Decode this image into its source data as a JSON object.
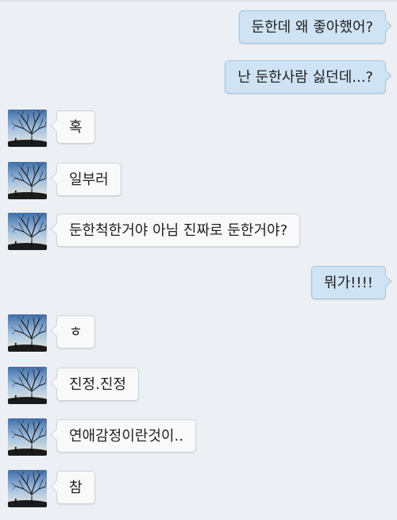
{
  "conversation": {
    "messages": [
      {
        "sender": "me",
        "text": "둔한데 왜 좋아했어?"
      },
      {
        "sender": "me",
        "text": "난 둔한사람 싫던데...?"
      },
      {
        "sender": "friend",
        "text": "혹"
      },
      {
        "sender": "friend",
        "text": "일부러"
      },
      {
        "sender": "friend",
        "text": "둔한척한거야 아님 진짜로 둔한거야?"
      },
      {
        "sender": "me",
        "text": "뭐가!!!!"
      },
      {
        "sender": "friend",
        "text": "ㅎ"
      },
      {
        "sender": "friend",
        "text": "진정.진정"
      },
      {
        "sender": "friend",
        "text": "연애감정이란것이.."
      },
      {
        "sender": "friend",
        "text": "참"
      }
    ]
  },
  "colors": {
    "background": "#eceff3",
    "outgoing_bubble": "#cfe3f5",
    "incoming_bubble": "#f9f9f9"
  },
  "icons": {
    "friend_avatar": "lone-tree-silhouette-icon"
  }
}
